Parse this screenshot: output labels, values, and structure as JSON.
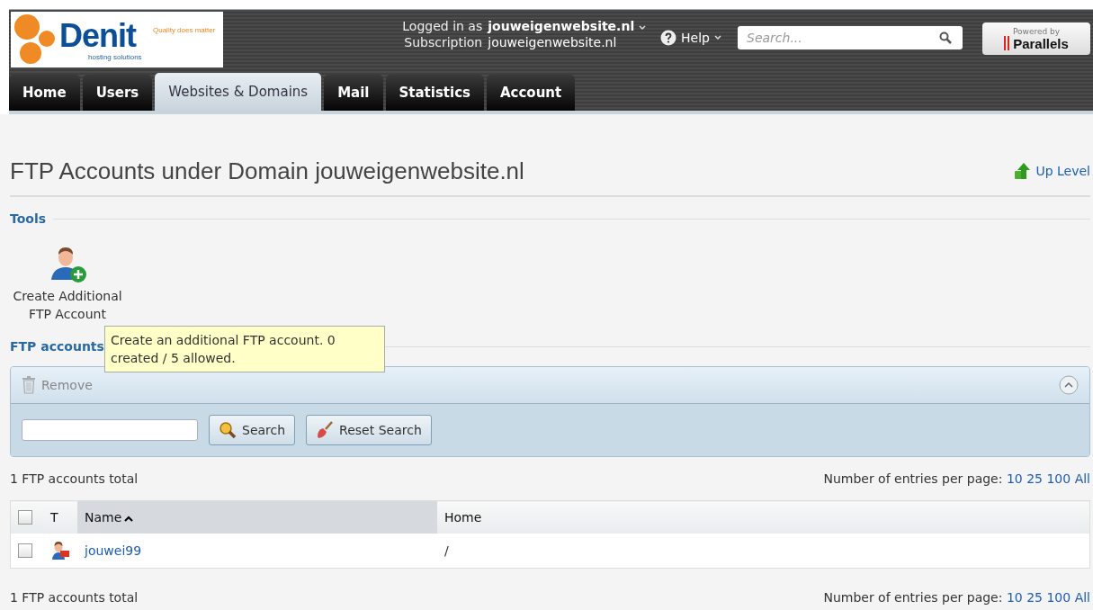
{
  "header": {
    "logo": {
      "name": "Denit",
      "tagline": "Quality does matter",
      "subtitle": "hosting solutions"
    },
    "login": {
      "logged_in_label": "Logged in as",
      "logged_in_value": "jouweigenwebsite.nl",
      "subscription_label": "Subscription",
      "subscription_value": "jouweigenwebsite.nl"
    },
    "help": "Help",
    "search": {
      "placeholder": "Search..."
    },
    "powered": {
      "label": "Powered by",
      "brand": "Parallels"
    }
  },
  "tabs": [
    {
      "label": "Home",
      "selected": false
    },
    {
      "label": "Users",
      "selected": false
    },
    {
      "label": "Websites & Domains",
      "selected": true
    },
    {
      "label": "Mail",
      "selected": false
    },
    {
      "label": "Statistics",
      "selected": false
    },
    {
      "label": "Account",
      "selected": false
    }
  ],
  "page": {
    "title": "FTP Accounts under Domain jouweigenwebsite.nl",
    "up_level": "Up Level"
  },
  "tools": {
    "heading": "Tools",
    "items": [
      {
        "label": "Create Additional FTP Account"
      }
    ],
    "tooltip": "Create an additional FTP account. 0 created / 5 allowed."
  },
  "list": {
    "heading": "FTP accounts",
    "remove": "Remove",
    "search_button": "Search",
    "reset_button": "Reset Search",
    "total": "1 FTP accounts total",
    "per_page_label": "Number of entries per page:",
    "per_page_options": [
      "10",
      "25",
      "100",
      "All"
    ],
    "columns": [
      {
        "label": "T",
        "sorted": false
      },
      {
        "label": "Name",
        "sorted": true
      },
      {
        "label": "Home",
        "sorted": false
      }
    ],
    "select_all_checked": false,
    "rows": [
      {
        "checked": false,
        "name": "jouwei99",
        "home": "/"
      }
    ],
    "footer_total": "1 FTP accounts total",
    "footer_per_page_label": "Number of entries per page:",
    "footer_per_page_options": [
      "10",
      "25",
      "100",
      "All"
    ]
  }
}
